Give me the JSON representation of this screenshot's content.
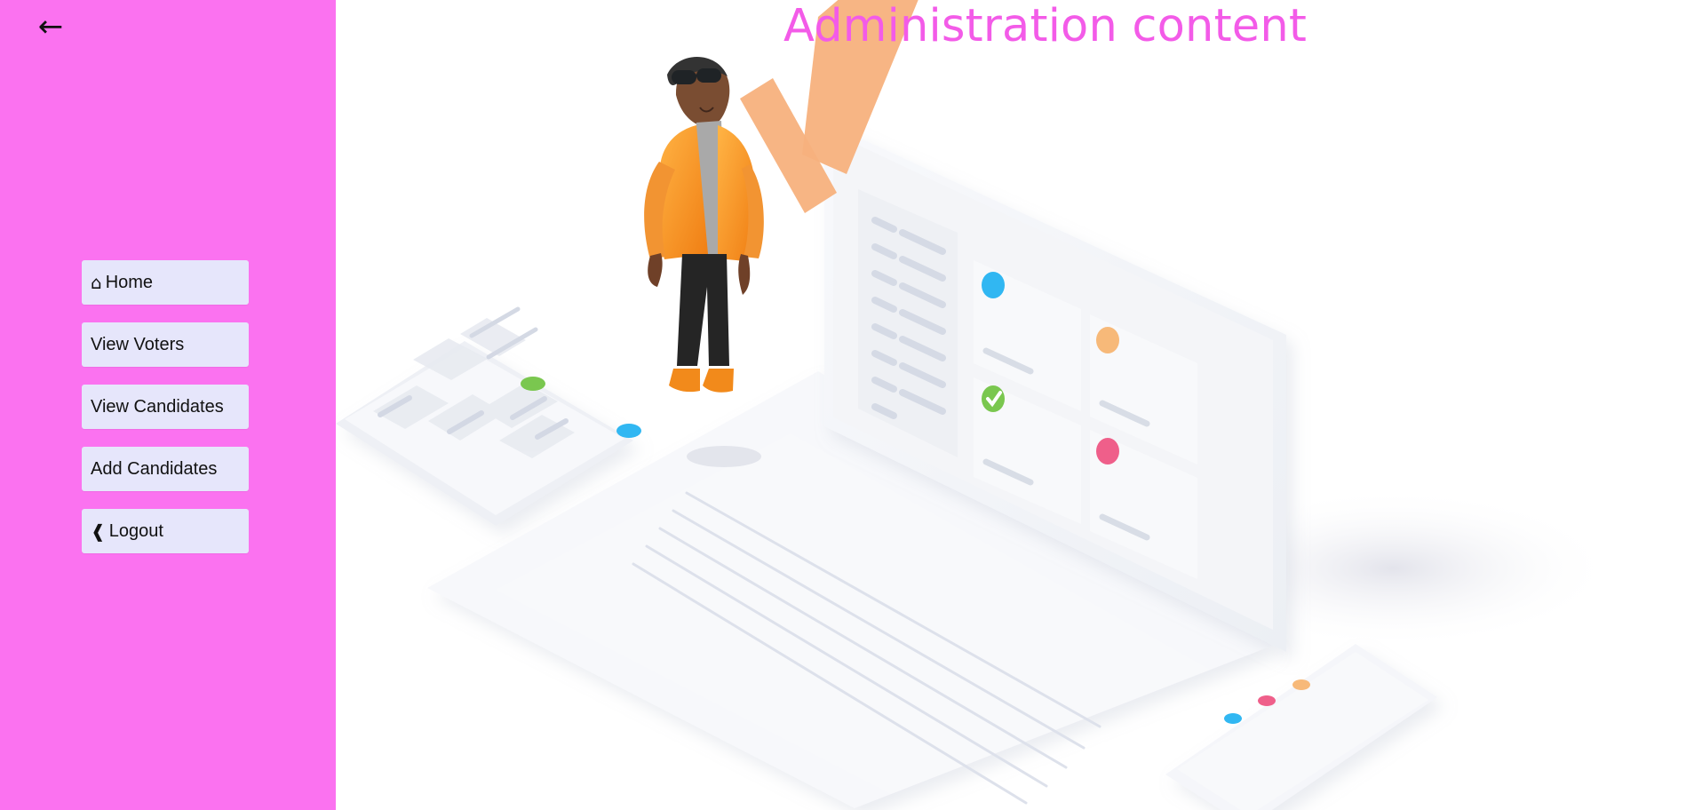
{
  "window": {
    "title": "Administration content"
  },
  "sidebar": {
    "back_label": "←",
    "items": [
      {
        "icon": "⌂",
        "label": "Home"
      },
      {
        "icon": "",
        "label": "View Voters"
      },
      {
        "icon": "",
        "label": "View Candidates"
      },
      {
        "icon": "",
        "label": "Add Candidates"
      },
      {
        "icon": "❰",
        "label": "Logout"
      }
    ]
  },
  "colors": {
    "sidebar_bg": "#fb72f0",
    "title": "#f35be8",
    "button_bg": "#e6e6fb",
    "accent_orange": "#f7a35c",
    "accent_blue": "#31b7f2",
    "accent_pink": "#ef5f8a",
    "accent_green": "#7ac74f"
  },
  "illustration": {
    "description": "voting illustration"
  }
}
